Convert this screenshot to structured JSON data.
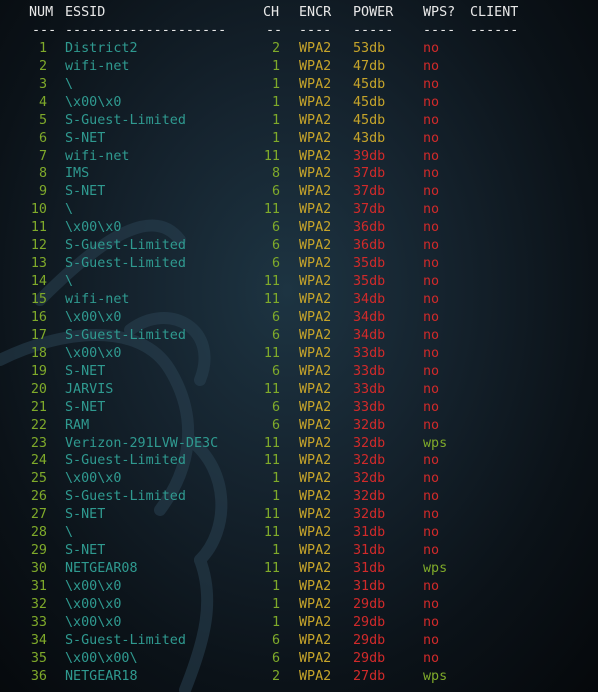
{
  "headers": {
    "num": "NUM",
    "essid": "ESSID",
    "ch": "CH",
    "encr": "ENCR",
    "power": "POWER",
    "wps": "WPS?",
    "client": "CLIENT"
  },
  "separators": {
    "num": "---",
    "essid": "--------------------",
    "ch": "--",
    "encr": "----",
    "power": "-----",
    "wps": "----",
    "client": "------"
  },
  "colors": {
    "num": "#7faa2a",
    "essid": "#2f9a90",
    "ch": "#7faa2a",
    "encr": "#c6a42a",
    "power_strong": "#c6a42a",
    "power_weak": "#d12a2a",
    "wps_no": "#d12a2a",
    "wps_yes": "#7faa2a",
    "header": "#e8e8e8"
  },
  "rows": [
    {
      "num": "1",
      "essid": "District2",
      "ch": "2",
      "encr": "WPA2",
      "power": "53db",
      "wps": "no"
    },
    {
      "num": "2",
      "essid": "wifi-net",
      "ch": "1",
      "encr": "WPA2",
      "power": "47db",
      "wps": "no"
    },
    {
      "num": "3",
      "essid": "\\",
      "ch": "1",
      "encr": "WPA2",
      "power": "45db",
      "wps": "no"
    },
    {
      "num": "4",
      "essid": "\\x00\\x0",
      "ch": "1",
      "encr": "WPA2",
      "power": "45db",
      "wps": "no"
    },
    {
      "num": "5",
      "essid": "S-Guest-Limited",
      "ch": "1",
      "encr": "WPA2",
      "power": "45db",
      "wps": "no"
    },
    {
      "num": "6",
      "essid": "S-NET",
      "ch": "1",
      "encr": "WPA2",
      "power": "43db",
      "wps": "no"
    },
    {
      "num": "7",
      "essid": "wifi-net",
      "ch": "11",
      "encr": "WPA2",
      "power": "39db",
      "wps": "no"
    },
    {
      "num": "8",
      "essid": "IMS",
      "ch": "8",
      "encr": "WPA2",
      "power": "37db",
      "wps": "no"
    },
    {
      "num": "9",
      "essid": "S-NET",
      "ch": "6",
      "encr": "WPA2",
      "power": "37db",
      "wps": "no"
    },
    {
      "num": "10",
      "essid": "\\",
      "ch": "11",
      "encr": "WPA2",
      "power": "37db",
      "wps": "no"
    },
    {
      "num": "11",
      "essid": "\\x00\\x0",
      "ch": "6",
      "encr": "WPA2",
      "power": "36db",
      "wps": "no"
    },
    {
      "num": "12",
      "essid": "S-Guest-Limited",
      "ch": "6",
      "encr": "WPA2",
      "power": "36db",
      "wps": "no"
    },
    {
      "num": "13",
      "essid": "S-Guest-Limited",
      "ch": "6",
      "encr": "WPA2",
      "power": "35db",
      "wps": "no"
    },
    {
      "num": "14",
      "essid": "\\",
      "ch": "11",
      "encr": "WPA2",
      "power": "35db",
      "wps": "no"
    },
    {
      "num": "15",
      "essid": "wifi-net",
      "ch": "11",
      "encr": "WPA2",
      "power": "34db",
      "wps": "no"
    },
    {
      "num": "16",
      "essid": "\\x00\\x0",
      "ch": "6",
      "encr": "WPA2",
      "power": "34db",
      "wps": "no"
    },
    {
      "num": "17",
      "essid": "S-Guest-Limited",
      "ch": "6",
      "encr": "WPA2",
      "power": "34db",
      "wps": "no"
    },
    {
      "num": "18",
      "essid": "\\x00\\x0",
      "ch": "11",
      "encr": "WPA2",
      "power": "33db",
      "wps": "no"
    },
    {
      "num": "19",
      "essid": "S-NET",
      "ch": "6",
      "encr": "WPA2",
      "power": "33db",
      "wps": "no"
    },
    {
      "num": "20",
      "essid": "JARVIS",
      "ch": "11",
      "encr": "WPA2",
      "power": "33db",
      "wps": "no"
    },
    {
      "num": "21",
      "essid": "S-NET",
      "ch": "6",
      "encr": "WPA2",
      "power": "33db",
      "wps": "no"
    },
    {
      "num": "22",
      "essid": "RAM",
      "ch": "6",
      "encr": "WPA2",
      "power": "32db",
      "wps": "no"
    },
    {
      "num": "23",
      "essid": "Verizon-291LVW-DE3C",
      "ch": "11",
      "encr": "WPA2",
      "power": "32db",
      "wps": "wps"
    },
    {
      "num": "24",
      "essid": "S-Guest-Limited",
      "ch": "11",
      "encr": "WPA2",
      "power": "32db",
      "wps": "no"
    },
    {
      "num": "25",
      "essid": "\\x00\\x0",
      "ch": "1",
      "encr": "WPA2",
      "power": "32db",
      "wps": "no"
    },
    {
      "num": "26",
      "essid": "S-Guest-Limited",
      "ch": "1",
      "encr": "WPA2",
      "power": "32db",
      "wps": "no"
    },
    {
      "num": "27",
      "essid": "S-NET",
      "ch": "11",
      "encr": "WPA2",
      "power": "32db",
      "wps": "no"
    },
    {
      "num": "28",
      "essid": "\\",
      "ch": "11",
      "encr": "WPA2",
      "power": "31db",
      "wps": "no"
    },
    {
      "num": "29",
      "essid": "S-NET",
      "ch": "1",
      "encr": "WPA2",
      "power": "31db",
      "wps": "no"
    },
    {
      "num": "30",
      "essid": "NETGEAR08",
      "ch": "11",
      "encr": "WPA2",
      "power": "31db",
      "wps": "wps"
    },
    {
      "num": "31",
      "essid": "\\x00\\x0",
      "ch": "1",
      "encr": "WPA2",
      "power": "31db",
      "wps": "no"
    },
    {
      "num": "32",
      "essid": "\\x00\\x0",
      "ch": "1",
      "encr": "WPA2",
      "power": "29db",
      "wps": "no"
    },
    {
      "num": "33",
      "essid": "\\x00\\x0",
      "ch": "1",
      "encr": "WPA2",
      "power": "29db",
      "wps": "no"
    },
    {
      "num": "34",
      "essid": "S-Guest-Limited",
      "ch": "6",
      "encr": "WPA2",
      "power": "29db",
      "wps": "no"
    },
    {
      "num": "35",
      "essid": "\\x00\\x00\\",
      "ch": "6",
      "encr": "WPA2",
      "power": "29db",
      "wps": "no"
    },
    {
      "num": "36",
      "essid": "NETGEAR18",
      "ch": "2",
      "encr": "WPA2",
      "power": "27db",
      "wps": "wps"
    }
  ]
}
